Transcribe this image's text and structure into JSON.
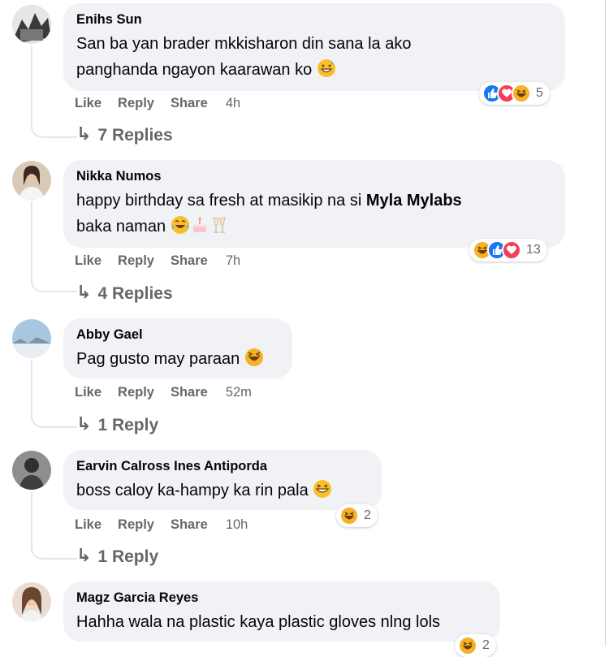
{
  "comments": [
    {
      "author": "Enihs Sun",
      "line1": "San ba yan brader mkkisharon din sana la ako",
      "line2": "panghanda ngayon kaarawan ko",
      "actions": {
        "like": "Like",
        "reply": "Reply",
        "share": "Share",
        "time": "4h"
      },
      "reaction_count": "5",
      "replies": "7 Replies"
    },
    {
      "author": "Nikka Numos",
      "line1_prefix": "happy birthday sa fresh at masikip na si ",
      "mention": "Myla Mylabs",
      "line2": "baka naman",
      "actions": {
        "like": "Like",
        "reply": "Reply",
        "share": "Share",
        "time": "7h"
      },
      "reaction_count": "13",
      "replies": "4 Replies"
    },
    {
      "author": "Abby Gael",
      "line1": "Pag gusto may paraan",
      "actions": {
        "like": "Like",
        "reply": "Reply",
        "share": "Share",
        "time": "52m"
      },
      "replies": "1 Reply"
    },
    {
      "author": "Earvin Calross Ines Antiporda",
      "line1": "boss caloy ka-hampy ka rin pala",
      "actions": {
        "like": "Like",
        "reply": "Reply",
        "share": "Share",
        "time": "10h"
      },
      "reaction_count": "2",
      "replies": "1 Reply"
    },
    {
      "author": "Magz Garcia Reyes",
      "line1": "Hahha wala na plastic kaya plastic gloves nlng lols",
      "reaction_count": "2"
    }
  ],
  "colors": {
    "bubble": "#f0f2f5",
    "meta": "#65676b",
    "like": "#1877f2",
    "love": "#f33e58",
    "haha": "#f7b125"
  }
}
